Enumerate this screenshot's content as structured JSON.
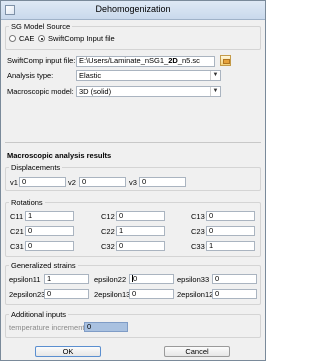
{
  "window": {
    "title": "Dehomogenization"
  },
  "source": {
    "group_label": "SG Model Source",
    "options": [
      "CAE",
      "SwiftComp Input file"
    ],
    "selected": "SwiftComp Input file"
  },
  "input_file": {
    "label": "SwiftComp input file:",
    "value_prefix": "E:\\Users/Laminate_nSG1_",
    "value_bold": "2D",
    "value_suffix": "_n5.sc"
  },
  "analysis_type": {
    "label": "Analysis type:",
    "value": "Elastic"
  },
  "macro_model": {
    "label": "Macroscopic model:",
    "value": "3D (solid)"
  },
  "results": {
    "heading": "Macroscopic analysis results",
    "displacements": {
      "label": "Displacements",
      "items": [
        {
          "label": "v1",
          "value": "0"
        },
        {
          "label": "v2",
          "value": "0"
        },
        {
          "label": "v3",
          "value": "0"
        }
      ]
    },
    "rotations": {
      "label": "Rotations",
      "rows": [
        [
          {
            "label": "C11",
            "value": "1"
          },
          {
            "label": "C12",
            "value": "0"
          },
          {
            "label": "C13",
            "value": "0"
          }
        ],
        [
          {
            "label": "C21",
            "value": "0"
          },
          {
            "label": "C22",
            "value": "1"
          },
          {
            "label": "C23",
            "value": "0"
          }
        ],
        [
          {
            "label": "C31",
            "value": "0"
          },
          {
            "label": "C32",
            "value": "0"
          },
          {
            "label": "C33",
            "value": "1"
          }
        ]
      ]
    },
    "strains": {
      "label": "Generalized strains",
      "rows": [
        [
          {
            "label": "epsilon11",
            "value": "1"
          },
          {
            "label": "epsilon22",
            "value": "0"
          },
          {
            "label": "epsilon33",
            "value": "0"
          }
        ],
        [
          {
            "label": "2epsilon23",
            "value": "0"
          },
          {
            "label": "2epsilon13",
            "value": "0"
          },
          {
            "label": "2epsilon12",
            "value": "0"
          }
        ]
      ]
    },
    "additional": {
      "label": "Additional inputs",
      "temperature_label": "temperature increment",
      "temperature_value": "0"
    }
  },
  "buttons": {
    "ok": "OK",
    "cancel": "Cancel"
  }
}
